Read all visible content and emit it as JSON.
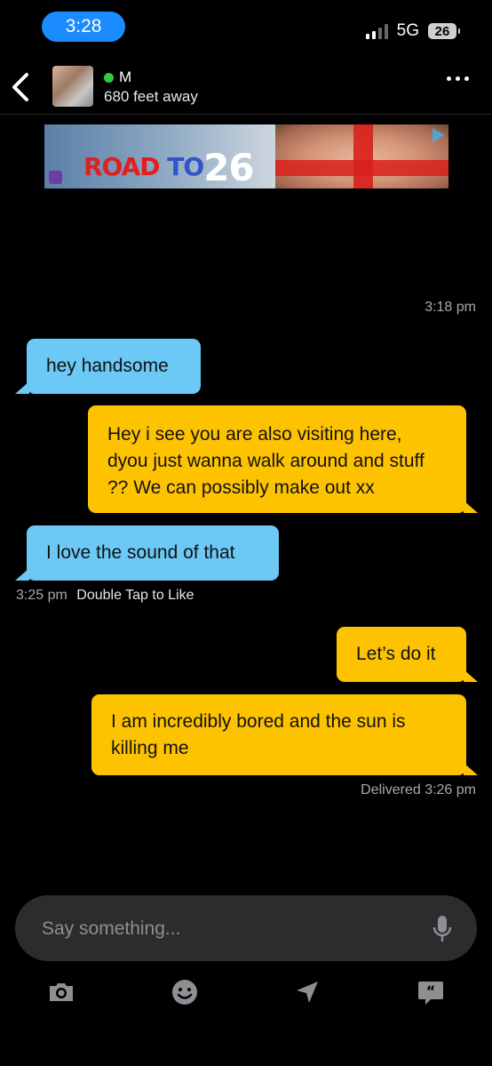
{
  "status_bar": {
    "time": "3:28",
    "network": "5G",
    "battery": "26"
  },
  "header": {
    "name": "M",
    "distance": "680 feet away",
    "online": true
  },
  "ad": {
    "text_road": "ROAD",
    "text_to": "TO",
    "text_num": "26"
  },
  "messages": {
    "timestamp_top": "3:18 pm",
    "m1": "hey handsome",
    "m2": "Hey i see you are also visiting here, dyou just wanna walk around and stuff ?? We can possibly make out xx",
    "m3": "I love the sound of that",
    "m3_time": "3:25 pm",
    "m3_hint": "Double Tap to Like",
    "m4": "Let’s do it",
    "m5": "I am incredibly bored and the sun is killing me",
    "delivered": "Delivered 3:26 pm"
  },
  "composer": {
    "placeholder": "Say something..."
  },
  "icons": [
    "back-chevron-icon",
    "more-icon",
    "mic-icon",
    "camera-icon",
    "smiley-icon",
    "location-arrow-icon",
    "quote-bubble-icon"
  ],
  "colors": {
    "incoming": "#6cc8f5",
    "outgoing": "#fec300",
    "online": "#2ecc40",
    "time_pill": "#1a8cff"
  }
}
